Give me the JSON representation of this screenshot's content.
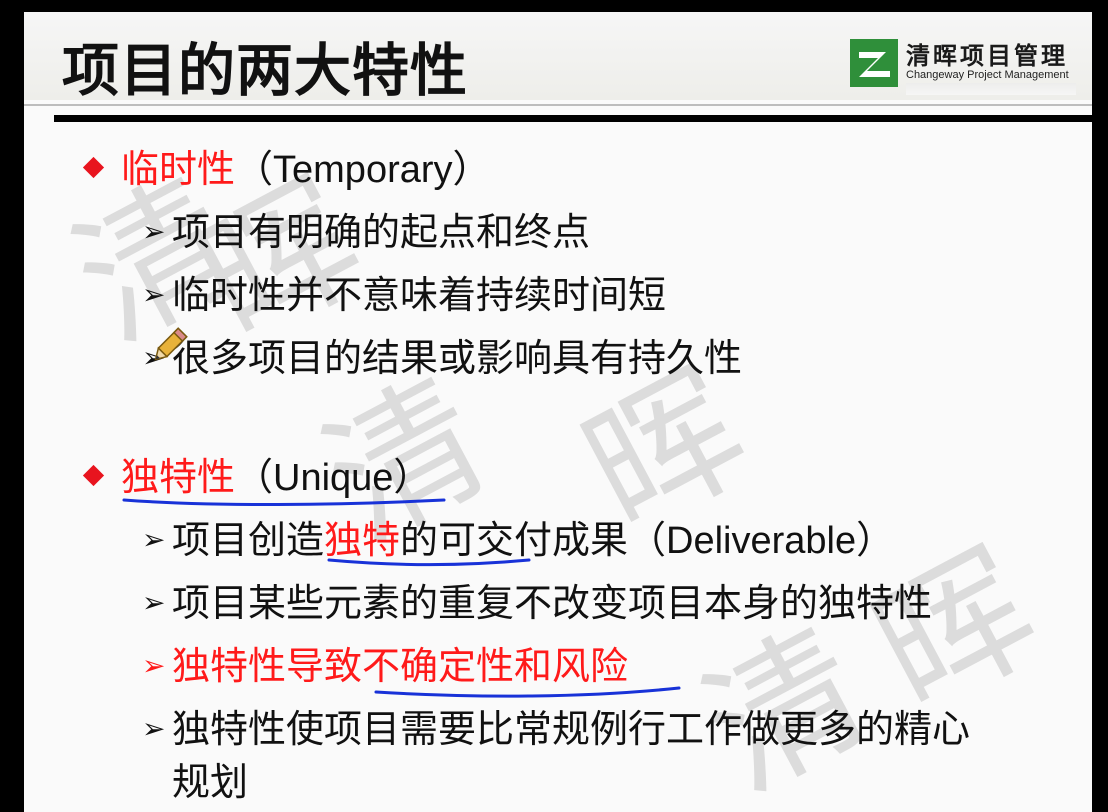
{
  "slide": {
    "title": "项目的两大特性",
    "logo": {
      "name_cn": "清晖项目管理",
      "name_en": "Changeway Project Management"
    },
    "watermark_char_1": "清",
    "watermark_char_2": "晖",
    "sections": [
      {
        "heading_red": "临时性",
        "heading_rest": "（Temporary）",
        "points": [
          "项目有明确的起点和终点",
          "临时性并不意味着持续时间短",
          "很多项目的结果或影响具有持久性"
        ]
      },
      {
        "heading_red": "独特性",
        "heading_rest": "（Unique）",
        "points": [
          {
            "pre": "项目创造",
            "red": "独特",
            "post": "的可交付成果（Deliverable）"
          },
          "项目某些元素的重复不改变项目本身的独特性",
          "独特性导致不确定性和风险",
          "独特性使项目需要比常规例行工作做更多的精心",
          "规划"
        ]
      }
    ],
    "bullet_arrow": "➢",
    "colors": {
      "accent_red": "#ff1a1a",
      "diamond_red": "#e8141e",
      "annotation_blue": "#1832d8",
      "logo_green": "#2f8f3a"
    }
  }
}
